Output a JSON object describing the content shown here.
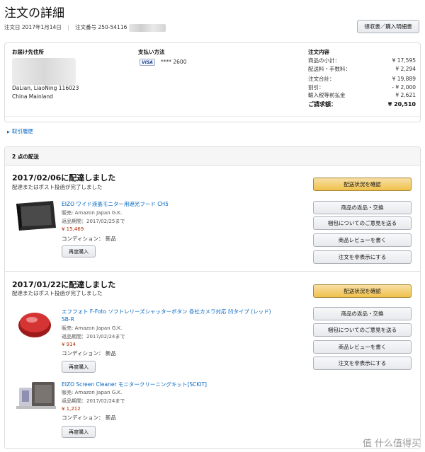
{
  "page": {
    "title": "注文の詳細",
    "order_date_label": "注文日 2017年1月14日",
    "order_number_label": "注文番号 250-54116"
  },
  "receipt_button": "領収書／購入明細書",
  "shipping_address": {
    "label": "お届け先住所",
    "line1": "DaLian, LiaoNing 116023",
    "line2": "China Mainland"
  },
  "payment": {
    "label": "支払い方法",
    "card_brand": "VISA",
    "card_masked": "**** 2600"
  },
  "summary": {
    "label": "注文内容",
    "rows": [
      {
        "label": "商品の小計：",
        "value": "¥ 17,595"
      },
      {
        "label": "配送料・手数料：",
        "value": "¥ 2,294"
      },
      {
        "label": "注文合計：",
        "value": "¥ 19,889"
      },
      {
        "label": "割引：",
        "value": "- ¥ 2,000"
      },
      {
        "label": "輸入税等前払金",
        "value": "¥ 2,621"
      }
    ],
    "total_label": "ご請求額：",
    "total_value": "¥ 20,510"
  },
  "history_link": "取引履歴",
  "shipments": {
    "header": "2 点の配送",
    "list": [
      {
        "date": "2017/02/06に配達しました",
        "status": "配達またはポスト投函が完了しました",
        "track_button": "配送状況を確認",
        "actions": [
          "商品の返品・交換",
          "梱包についてのご意見を送る",
          "商品レビューを書く",
          "注文を非表示にする"
        ],
        "items": [
          {
            "title": "EIZO ワイド液晶モニター用遮光フード CH5",
            "seller": "販売: Amazon Japan G.K.",
            "return": "返品期間：2017/02/25まで",
            "price": "¥ 15,469",
            "condition": "コンディション： 新品",
            "rebuy": "再度購入"
          }
        ]
      },
      {
        "date": "2017/01/22に配達しました",
        "status": "配達またはポスト投函が完了しました",
        "track_button": "配送状況を確認",
        "actions": [
          "商品の返品・交換",
          "梱包についてのご意見を送る",
          "商品レビューを書く",
          "注文を非表示にする"
        ],
        "items": [
          {
            "title": "エフフォト F-Foto ソフトレリーズシャッターボタン 各社カメラ対応 凹タイプ (レッド)",
            "title2": "SB-R",
            "seller": "販売: Amazon Japan G.K.",
            "return": "返品期間：2017/02/24まで",
            "price": "¥ 914",
            "condition": "コンディション： 新品",
            "rebuy": "再度購入"
          },
          {
            "title": "EIZO Screen Cleaner モニタークリーニングキット[SCKIT]",
            "seller": "販売: Amazon Japan G.K.",
            "return": "返品期間：2017/02/24まで",
            "price": "¥ 1,212",
            "condition": "コンディション： 新品",
            "rebuy": "再度購入"
          }
        ]
      }
    ]
  },
  "watermark": "值 什么值得买",
  "colors": {
    "link": "#0066c0",
    "price": "#b12704",
    "primary_button": "#f0c14b"
  }
}
